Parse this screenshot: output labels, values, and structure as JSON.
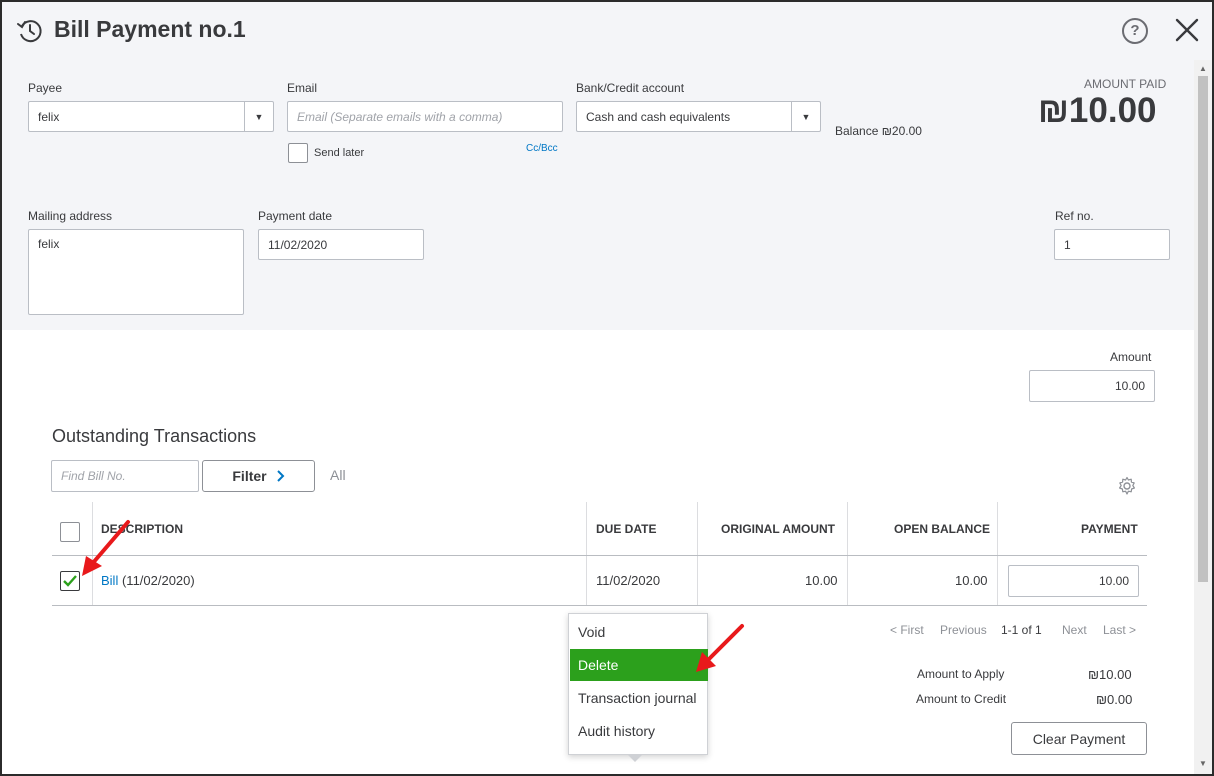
{
  "header": {
    "title": "Bill Payment no.1",
    "icons": {
      "recent": "history-icon",
      "help": "help-icon",
      "close": "close-icon"
    },
    "help_glyph": "?"
  },
  "form": {
    "payee": {
      "label": "Payee",
      "value": "felix"
    },
    "email": {
      "label": "Email",
      "placeholder": "Email (Separate emails with a comma)",
      "cc_bcc": "Cc/Bcc",
      "send_later": "Send later"
    },
    "bank": {
      "label": "Bank/Credit account",
      "value": "Cash and cash equivalents",
      "balance": "Balance ₪20.00"
    },
    "amount_paid": {
      "label": "AMOUNT PAID",
      "value": "₪10.00"
    },
    "mailing_address": {
      "label": "Mailing address",
      "value": "felix"
    },
    "payment_date": {
      "label": "Payment date",
      "value": "11/02/2020"
    },
    "ref_no": {
      "label": "Ref no.",
      "value": "1"
    }
  },
  "amount": {
    "label": "Amount",
    "value": "10.00"
  },
  "outstanding": {
    "title": "Outstanding Transactions",
    "find_placeholder": "Find Bill No.",
    "filter_label": "Filter",
    "filter_value": "All",
    "columns": [
      "DESCRIPTION",
      "DUE DATE",
      "ORIGINAL AMOUNT",
      "OPEN BALANCE",
      "PAYMENT"
    ],
    "rows": [
      {
        "checked": true,
        "link": "Bill",
        "desc": "(11/02/2020)",
        "due_date": "11/02/2020",
        "original": "10.00",
        "open": "10.00",
        "payment": "10.00"
      }
    ],
    "pagination": {
      "first": "< First",
      "previous": "Previous",
      "range": "1-1 of 1",
      "next": "Next",
      "last": "Last >"
    }
  },
  "totals": {
    "apply_label": "Amount to Apply",
    "apply_value": "₪10.00",
    "credit_label": "Amount to Credit",
    "credit_value": "₪0.00"
  },
  "clear_payment": "Clear Payment",
  "context_menu": {
    "items": [
      "Void",
      "Delete",
      "Transaction journal",
      "Audit history"
    ],
    "active_index": 1
  },
  "colors": {
    "accent_green": "#2ca01c",
    "link_blue": "#0077c5",
    "annotation_arrow": "#e8191b"
  }
}
